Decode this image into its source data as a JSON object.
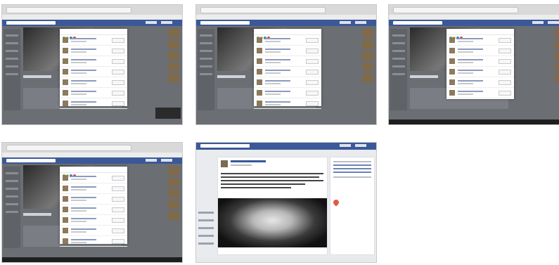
{
  "screenshots": [
    {
      "id": "thumb-1",
      "dialog": true,
      "rows": 7,
      "toast": true
    },
    {
      "id": "thumb-2",
      "dialog": true,
      "rows": 7,
      "toast": false
    },
    {
      "id": "thumb-3",
      "dialog": true,
      "rows": 6,
      "toast": false
    },
    {
      "id": "thumb-4",
      "dialog": true,
      "rows": 7,
      "toast": false
    },
    {
      "id": "thumb-5",
      "dialog": false,
      "rows": 0,
      "toast": false
    }
  ],
  "colors": {
    "facebook_blue": "#3b5998",
    "dialog_dots": [
      "#4caf50",
      "#fbc02d",
      "#1e88e5",
      "#e53935"
    ]
  },
  "icons": [
    "chrome-window",
    "facebook-bar",
    "location-pin-icon",
    "taskbar"
  ]
}
